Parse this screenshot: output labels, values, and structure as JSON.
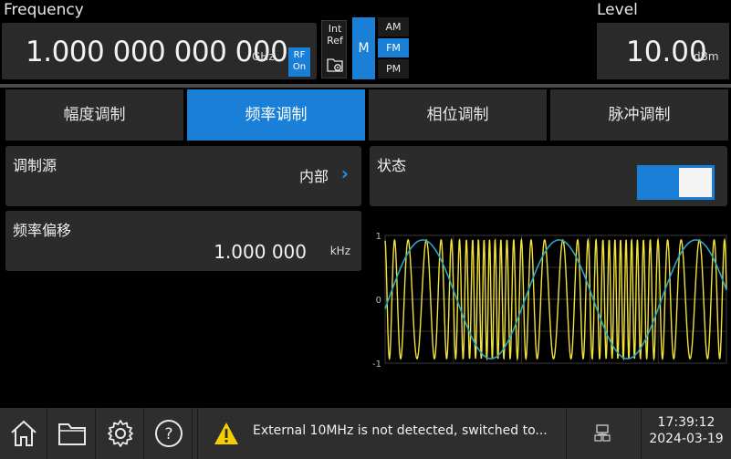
{
  "header": {
    "frequency_label": "Frequency",
    "frequency_value": "1.000 000 000 000",
    "frequency_unit": "GHz",
    "rf_line1": "RF",
    "rf_line2": "On",
    "ref_line1": "Int",
    "ref_line2": "Ref",
    "mod_label": "M",
    "mod_options": [
      "AM",
      "FM",
      "PM"
    ],
    "mod_selected": "FM",
    "level_label": "Level",
    "level_value": "10.00",
    "level_unit": "dBm"
  },
  "tabs": [
    {
      "label": "幅度调制",
      "active": false
    },
    {
      "label": "频率调制",
      "active": true
    },
    {
      "label": "相位调制",
      "active": false
    },
    {
      "label": "脉冲调制",
      "active": false
    }
  ],
  "source": {
    "label": "调制源",
    "value": "内部"
  },
  "state": {
    "label": "状态",
    "on": true
  },
  "deviation": {
    "label": "频率偏移",
    "value": "1.000 000",
    "unit": "kHz"
  },
  "chart_data": {
    "type": "line",
    "yticks": [
      "1",
      "0",
      "-1"
    ],
    "ylim": [
      -1,
      1
    ],
    "series": [
      {
        "color": "#2aa7c7",
        "shape": "sine",
        "cycles": 2.5
      },
      {
        "color": "#f2e23a",
        "shape": "fm-carrier",
        "cycles": 40
      }
    ]
  },
  "status": {
    "message": "External 10MHz is not detected, switched to...",
    "time": "17:39:12",
    "date": "2024-03-19"
  },
  "colors": {
    "accent": "#1a7fd6",
    "warning": "#f5d000"
  }
}
